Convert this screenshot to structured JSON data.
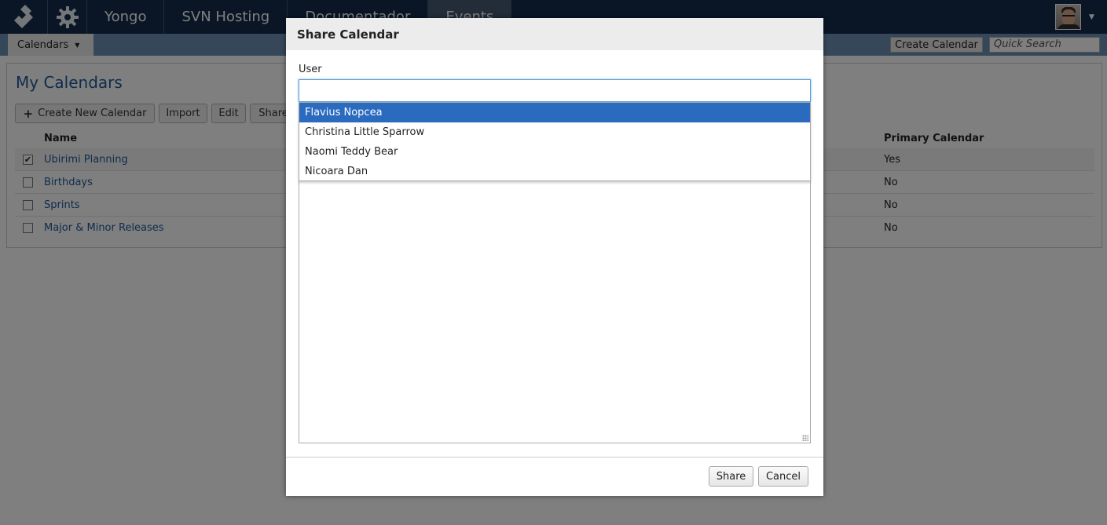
{
  "topbar": {
    "nav": [
      "Yongo",
      "SVN Hosting",
      "Documentador",
      "Events"
    ]
  },
  "subbar": {
    "calendars_label": "Calendars",
    "create_calendar_label": "Create Calendar",
    "quick_search_placeholder": "Quick Search"
  },
  "page": {
    "title": "My Calendars",
    "toolbar": {
      "create_new": "Create New Calendar",
      "import": "Import",
      "edit": "Edit",
      "share": "Share"
    },
    "columns": {
      "name": "Name",
      "primary": "Primary Calendar"
    },
    "rows": [
      {
        "name": "Ubirimi Planning",
        "primary": "Yes",
        "checked": true
      },
      {
        "name": "Birthdays",
        "primary": "No",
        "checked": false
      },
      {
        "name": "Sprints",
        "primary": "No",
        "checked": false
      },
      {
        "name": "Major & Minor Releases",
        "primary": "No",
        "checked": false
      }
    ]
  },
  "dialog": {
    "title": "Share Calendar",
    "user_label": "User",
    "user_value": "",
    "suggestions": [
      "Flavius Nopcea",
      "Christina Little Sparrow",
      "Naomi Teddy Bear",
      "Nicoara Dan"
    ],
    "highlighted_index": 0,
    "share_button": "Share",
    "cancel_button": "Cancel"
  },
  "colors": {
    "topbar_bg": "#142d4c",
    "subbar_bg": "#6c8eb3",
    "link": "#1e5896",
    "highlight": "#2a6bbf"
  },
  "icons": [
    "logo-icon",
    "gear-icon",
    "chevron-down-icon",
    "plus-icon",
    "checkbox-checked-icon",
    "resize-handle-icon"
  ]
}
